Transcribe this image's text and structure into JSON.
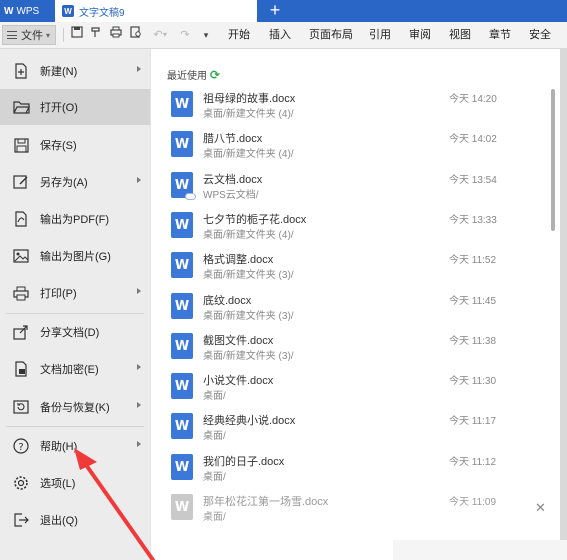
{
  "titlebar": {
    "app_tab": "WPS",
    "doc_tab": "文字文稿9",
    "new_tab": "+"
  },
  "toolbar": {
    "file_label": "文件",
    "ribbon_tabs": [
      "开始",
      "插入",
      "页面布局",
      "引用",
      "审阅",
      "视图",
      "章节",
      "安全"
    ]
  },
  "file_menu": {
    "items": [
      {
        "label": "新建(N)",
        "icon": "new-doc-icon",
        "has_submenu": true
      },
      {
        "label": "打开(O)",
        "icon": "open-folder-icon",
        "has_submenu": false,
        "active": true
      },
      {
        "label": "保存(S)",
        "icon": "save-icon",
        "has_submenu": false
      },
      {
        "label": "另存为(A)",
        "icon": "save-as-icon",
        "has_submenu": true
      },
      {
        "label": "输出为PDF(F)",
        "icon": "export-pdf-icon",
        "has_submenu": false
      },
      {
        "label": "输出为图片(G)",
        "icon": "export-image-icon",
        "has_submenu": false
      },
      {
        "label": "打印(P)",
        "icon": "print-icon",
        "has_submenu": true
      },
      {
        "label": "分享文档(D)",
        "icon": "share-icon",
        "has_submenu": false
      },
      {
        "label": "文档加密(E)",
        "icon": "encrypt-icon",
        "has_submenu": true
      },
      {
        "label": "备份与恢复(K)",
        "icon": "backup-icon",
        "has_submenu": true
      },
      {
        "label": "帮助(H)",
        "icon": "help-icon",
        "has_submenu": true
      },
      {
        "label": "选项(L)",
        "icon": "settings-icon",
        "has_submenu": false
      },
      {
        "label": "退出(Q)",
        "icon": "exit-icon",
        "has_submenu": false
      }
    ]
  },
  "recent": {
    "title": "最近使用",
    "files": [
      {
        "name": "祖母绿的故事.docx",
        "path": "桌面/新建文件夹 (4)/",
        "time": "今天 14:20"
      },
      {
        "name": "腊八节.docx",
        "path": "桌面/新建文件夹 (4)/",
        "time": "今天 14:02"
      },
      {
        "name": "云文档.docx",
        "path": "WPS云文档/",
        "time": "今天 13:54"
      },
      {
        "name": "七夕节的栀子花.docx",
        "path": "桌面/新建文件夹 (4)/",
        "time": "今天 13:33"
      },
      {
        "name": "格式调整.docx",
        "path": "桌面/新建文件夹 (3)/",
        "time": "今天 11:52"
      },
      {
        "name": "底纹.docx",
        "path": "桌面/新建文件夹 (3)/",
        "time": "今天 11:45"
      },
      {
        "name": "截图文件.docx",
        "path": "桌面/新建文件夹 (3)/",
        "time": "今天 11:38"
      },
      {
        "name": "小说文件.docx",
        "path": "桌面/",
        "time": "今天 11:30"
      },
      {
        "name": "经典经典小说.docx",
        "path": "桌面/",
        "time": "今天 11:17"
      },
      {
        "name": "我们的日子.docx",
        "path": "桌面/",
        "time": "今天 11:12"
      },
      {
        "name": "那年松花江第一场雪.docx",
        "path": "桌面/",
        "time": "今天 11:09"
      }
    ]
  },
  "colors": {
    "brand_blue": "#2a66c5",
    "doc_icon_blue": "#3b78d8",
    "annotation_red": "#f03a3a"
  }
}
